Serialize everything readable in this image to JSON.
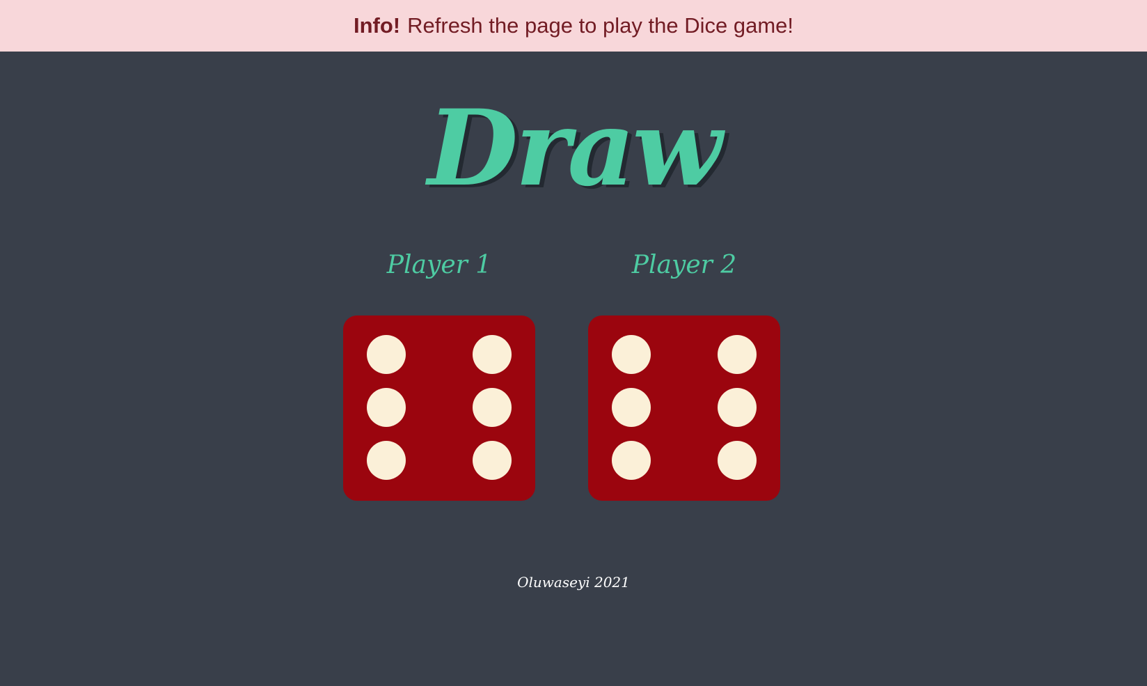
{
  "alert": {
    "strong": "Info!",
    "message": "Refresh the page to play the Dice game!"
  },
  "result_title": "Draw",
  "players": [
    {
      "label": "Player 1",
      "die_value": 6
    },
    {
      "label": "Player 2",
      "die_value": 6
    }
  ],
  "colors": {
    "background": "#393f4a",
    "accent": "#4ecca3",
    "die": "#9b050e",
    "pip": "#fbf0d8",
    "alert_bg": "#f8d7da",
    "alert_text": "#721c24"
  },
  "footer": "Oluwaseyi 2021"
}
